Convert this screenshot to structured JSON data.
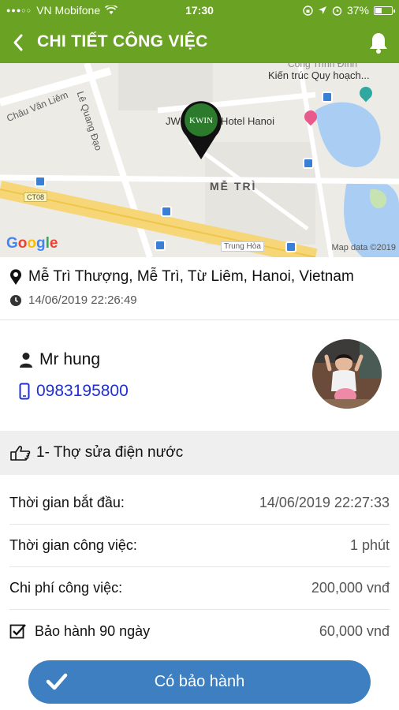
{
  "status_bar": {
    "carrier": "VN Mobifone",
    "time": "17:30",
    "battery": "37%",
    "battery_level": 0.37
  },
  "header": {
    "title": "CHI TIẾT CÔNG VIỆC",
    "back_icon": "chevron-left-icon",
    "bell_icon": "bell-icon",
    "color": "#6aa324"
  },
  "map": {
    "labels": {
      "chau_van_liem": "Châu Văn Liêm",
      "le_quang_dao": "Lê Quang Đạo",
      "poi_top": "Công Trình Đình",
      "poi_architecture": "Kiến trúc Quy hoạch...",
      "hotel": "JW Marriott Hotel Hanoi",
      "district": "MỄ TRÌ",
      "trung_hoa": "Trung Hòa",
      "road_ct08": "CT08",
      "pin_text": "KWIN"
    },
    "google": "Google",
    "attribution": "Map data ©2019"
  },
  "address": {
    "text": "Mễ Trì Thượng, Mễ Trì, Từ Liêm, Hanoi, Vietnam",
    "timestamp": "14/06/2019 22:26:49"
  },
  "customer": {
    "name": "Mr hung",
    "phone": "0983195800"
  },
  "service": {
    "title": "1- Thợ sửa điện nước"
  },
  "details": [
    {
      "label": "Thời gian bắt đầu:",
      "value": "14/06/2019 22:27:33"
    },
    {
      "label": "Thời gian công việc:",
      "value": "1 phút"
    },
    {
      "label": "Chi phí công việc:",
      "value": "200,000 vnđ"
    },
    {
      "label": "Bảo hành 90 ngày",
      "value": "60,000 vnđ",
      "checked": true
    }
  ],
  "cta": {
    "label": "Có bảo hành",
    "color": "#3d7fc1"
  }
}
